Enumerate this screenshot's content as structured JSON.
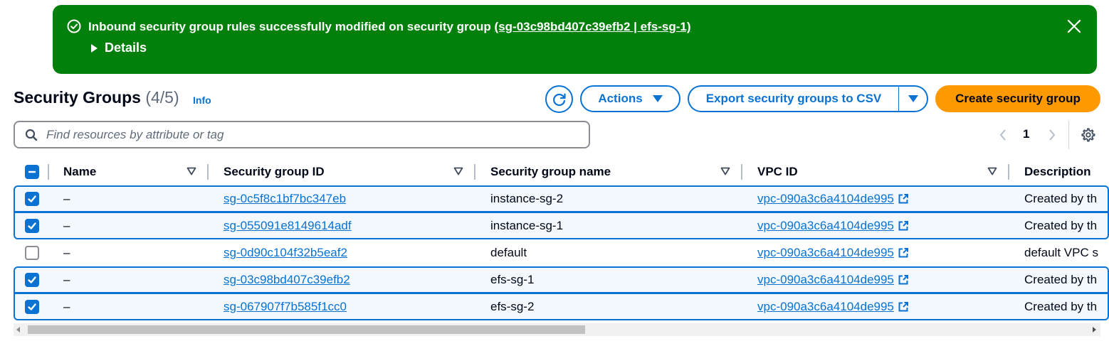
{
  "flash": {
    "message_prefix": "Inbound security group rules successfully modified on security group ",
    "link_text": "(sg-03c98bd407c39efb2 | efs-sg-1)",
    "details_label": "Details",
    "color": "#037f0c"
  },
  "header": {
    "title": "Security Groups",
    "count": "(4/5)",
    "info": "Info"
  },
  "toolbar": {
    "refresh_icon": "refresh-icon",
    "actions_label": "Actions",
    "export_label": "Export security groups to CSV",
    "create_label": "Create security group",
    "create_color": "#ff9900"
  },
  "search": {
    "placeholder": "Find resources by attribute or tag",
    "value": ""
  },
  "pagination": {
    "current_page": "1"
  },
  "table": {
    "columns": [
      "Name",
      "Security group ID",
      "Security group name",
      "VPC ID",
      "Description"
    ],
    "rows": [
      {
        "selected": true,
        "name": "–",
        "sg_id": "sg-0c5f8c1bf7bc347eb",
        "sg_name": "instance-sg-2",
        "vpc_id": "vpc-090a3c6a4104de995",
        "description": "Created by th"
      },
      {
        "selected": true,
        "name": "–",
        "sg_id": "sg-055091e8149614adf",
        "sg_name": "instance-sg-1",
        "vpc_id": "vpc-090a3c6a4104de995",
        "description": "Created by th"
      },
      {
        "selected": false,
        "name": "–",
        "sg_id": "sg-0d90c104f32b5eaf2",
        "sg_name": "default",
        "vpc_id": "vpc-090a3c6a4104de995",
        "description": "default VPC s"
      },
      {
        "selected": true,
        "name": "–",
        "sg_id": "sg-03c98bd407c39efb2",
        "sg_name": "efs-sg-1",
        "vpc_id": "vpc-090a3c6a4104de995",
        "description": "Created by th"
      },
      {
        "selected": true,
        "name": "–",
        "sg_id": "sg-067907f7b585f1cc0",
        "sg_name": "efs-sg-2",
        "vpc_id": "vpc-090a3c6a4104de995",
        "description": "Created by th"
      }
    ]
  },
  "colors": {
    "link": "#0972d3",
    "selected_bg": "#f2f8fd"
  }
}
